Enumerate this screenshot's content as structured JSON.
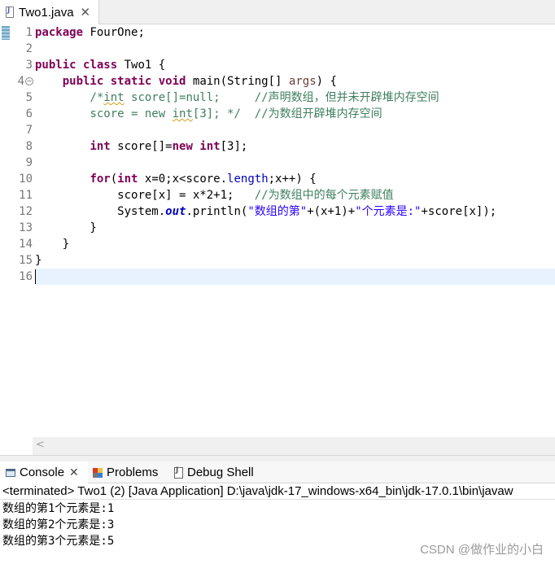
{
  "editor_tab": {
    "label": "Two1.java",
    "close": "✕"
  },
  "gutter": {
    "line_numbers": [
      "1",
      "2",
      "3",
      "4",
      "5",
      "6",
      "7",
      "8",
      "9",
      "10",
      "11",
      "12",
      "13",
      "14",
      "15",
      "16"
    ],
    "fold_marker": "−"
  },
  "code": {
    "l1": {
      "kw": "package",
      "rest": " FourOne;"
    },
    "l3": {
      "kw1": "public",
      "kw2": "class",
      "rest": " Two1 {"
    },
    "l4": {
      "indent": "    ",
      "kw1": "public",
      "kw2": "static",
      "kw3": "void",
      "mid": " main(String[] ",
      "param": "args",
      "end": ") {"
    },
    "l5": {
      "indent": "        ",
      "c1": "/*",
      "c2": "int",
      "c3": " score[]=null;     //声明数组，但并未开辟堆内存空间"
    },
    "l6": {
      "indent": "        ",
      "c1": "score = new ",
      "c2": "int",
      "c3": "[3]; */  //为数组开辟堆内存空间"
    },
    "l8": {
      "indent": "        ",
      "kw1": "int",
      "mid": " score[]=",
      "kw2": "new",
      "sp": " ",
      "kw3": "int",
      "end": "[3];"
    },
    "l10": {
      "indent": "        ",
      "kw1": "for",
      "p1": "(",
      "kw2": "int",
      "p2": " x=0;x<score.",
      "fld": "length",
      "p3": ";x++) {"
    },
    "l11": {
      "indent": "            ",
      "code": "score[x] = x*2+1;   ",
      "cm": "//为数组中的每个元素赋值"
    },
    "l12": {
      "indent": "            ",
      "p1": "System.",
      "sfld": "out",
      "p2": ".println(",
      "s1": "\"数组的第\"",
      "p3": "+(x+1)+",
      "s2": "\"个元素是:\"",
      "p4": "+score[x]);"
    },
    "l13": {
      "text": "        }"
    },
    "l14": {
      "text": "    }"
    },
    "l15": {
      "text": "}"
    }
  },
  "editor_scrollbar": {
    "left_arrow": "<"
  },
  "console_tabs": [
    {
      "label": "Console",
      "close": "✕"
    },
    {
      "label": "Problems"
    },
    {
      "label": "Debug Shell"
    }
  ],
  "console": {
    "header": "<terminated> Two1 (2) [Java Application] D:\\java\\jdk-17_windows-x64_bin\\jdk-17.0.1\\bin\\javaw",
    "output": [
      "数组的第1个元素是:1",
      "数组的第2个元素是:3",
      "数组的第3个元素是:5"
    ]
  },
  "watermark": "CSDN @做作业的小白"
}
